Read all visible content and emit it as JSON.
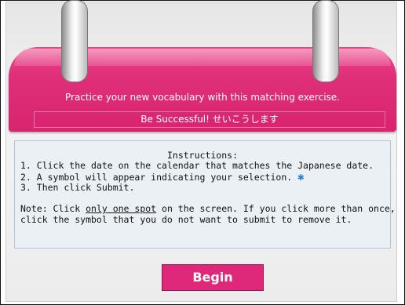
{
  "header": {
    "subtitle": "Practice your new vocabulary with this matching exercise.",
    "motto": "Be Successful! せいこうします"
  },
  "instructions": {
    "title": "Instructions:",
    "step1": "1. Click the date on the calendar that matches the Japanese date.",
    "step2": "2. A symbol will appear indicating your selection.",
    "step3": "3. Then click Submit.",
    "note_prefix": "Note: Click ",
    "note_emphasis": "only one spot",
    "note_suffix": " on the screen.  If you click more than once,",
    "note_line2": "click the symbol that you do not want to submit to remove it.",
    "symbol_icon": "snowflake-icon"
  },
  "actions": {
    "begin_label": "Begin"
  },
  "colors": {
    "accent": "#e0287a",
    "panel_border": "#a8c7d8",
    "symbol": "#2f7ed6"
  }
}
